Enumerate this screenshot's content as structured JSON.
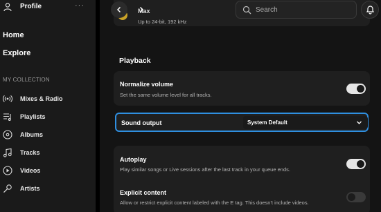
{
  "sidebar": {
    "profile_label": "Profile",
    "more_label": "···",
    "home_label": "Home",
    "explore_label": "Explore",
    "collection_header": "MY COLLECTION",
    "items": [
      {
        "label": "Mixes & Radio",
        "icon": "radio-waves-icon"
      },
      {
        "label": "Playlists",
        "icon": "playlist-icon"
      },
      {
        "label": "Albums",
        "icon": "album-disc-icon"
      },
      {
        "label": "Tracks",
        "icon": "music-note-icon"
      },
      {
        "label": "Videos",
        "icon": "video-play-icon"
      },
      {
        "label": "Artists",
        "icon": "microphone-icon"
      }
    ]
  },
  "header": {
    "back_icon": "chevron-left-icon",
    "forward_icon": "chevron-right-icon",
    "search_placeholder": "Search",
    "notifications_icon": "bell-icon"
  },
  "quality": {
    "title": "Max",
    "subtitle": "Up to 24-bit, 192 kHz"
  },
  "playback": {
    "section_title": "Playback",
    "normalize": {
      "title": "Normalize volume",
      "description": "Set the same volume level for all tracks.",
      "enabled": true
    },
    "sound_output": {
      "title": "Sound output",
      "selected": "System Default"
    },
    "autoplay": {
      "title": "Autoplay",
      "description": "Play similar songs or Live sessions after the last track in your queue ends.",
      "enabled": true
    },
    "explicit": {
      "title": "Explicit content",
      "description": "Allow or restrict explicit content labeled with the E tag. This doesn't include videos.",
      "enabled": false
    }
  },
  "colors": {
    "focus_ring": "#2f8fe0",
    "quality_badge": "#c9a227",
    "toggle_on": "#e6e6e6",
    "toggle_off": "#3a3a3a"
  }
}
